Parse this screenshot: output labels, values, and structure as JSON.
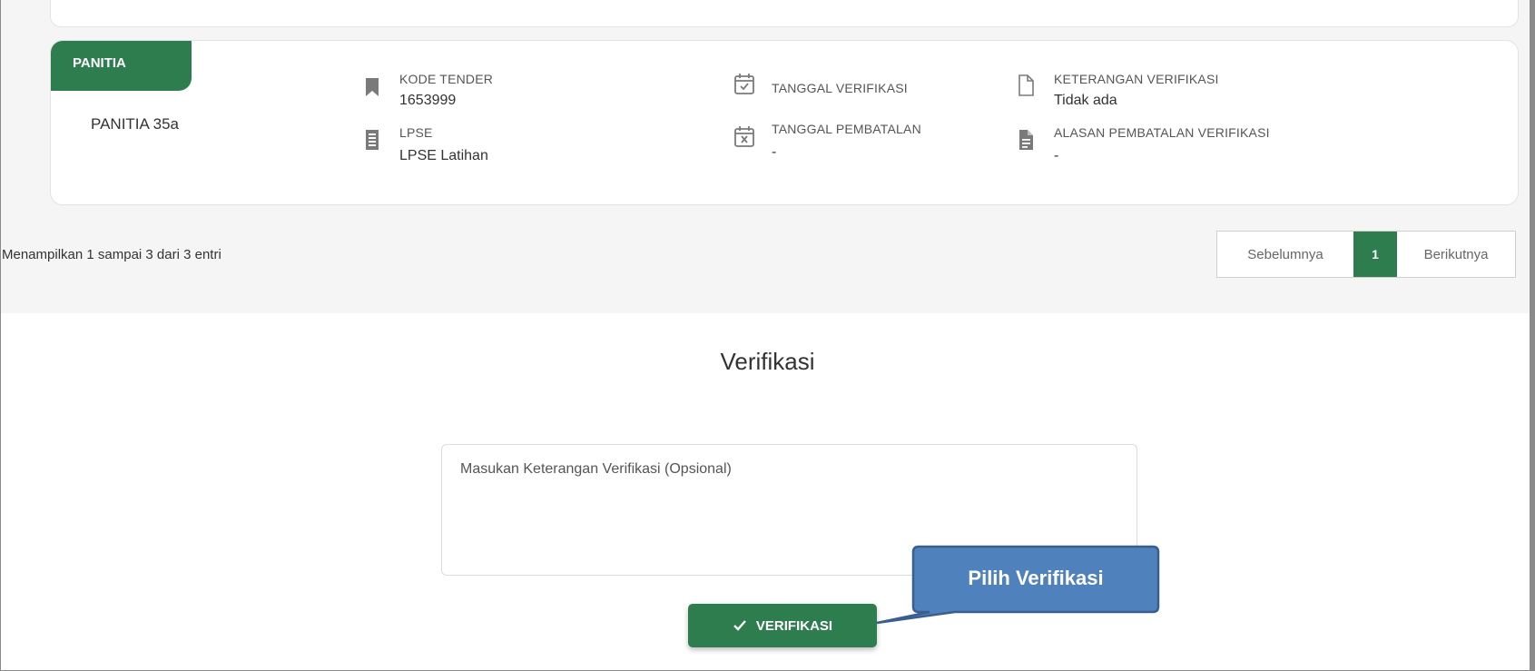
{
  "card": {
    "panitia_tab": "PANITIA",
    "panitia_name": "PANITIA 35a",
    "kode_tender_label": "KODE TENDER",
    "kode_tender_value": "1653999",
    "lpse_label": "LPSE",
    "lpse_value": "LPSE Latihan",
    "tanggal_verifikasi_label": "TANGGAL VERIFIKASI",
    "tanggal_pembatalan_label": "TANGGAL PEMBATALAN",
    "tanggal_pembatalan_value": "-",
    "keterangan_label": "KETERANGAN VERIFIKASI",
    "keterangan_value": "Tidak ada",
    "alasan_label": "ALASAN PEMBATALAN VERIFIKASI",
    "alasan_value": "-"
  },
  "pagination": {
    "info": "Menampilkan 1 sampai 3 dari 3 entri",
    "prev": "Sebelumnya",
    "current": "1",
    "next": "Berikutnya"
  },
  "verification": {
    "title": "Verifikasi",
    "placeholder": "Masukan Keterangan Verifikasi (Opsional)",
    "button_label": "VERIFIKASI"
  },
  "callout": {
    "text": "Pilih Verifikasi"
  },
  "colors": {
    "primary_green": "#2e7d4f",
    "callout_blue": "#4f81bd",
    "callout_border": "#3a5f8f"
  },
  "icons": [
    "bookmark-icon",
    "building-icon",
    "calendar-check-icon",
    "calendar-x-icon",
    "document-icon",
    "document-filled-icon",
    "checkmark-icon"
  ]
}
